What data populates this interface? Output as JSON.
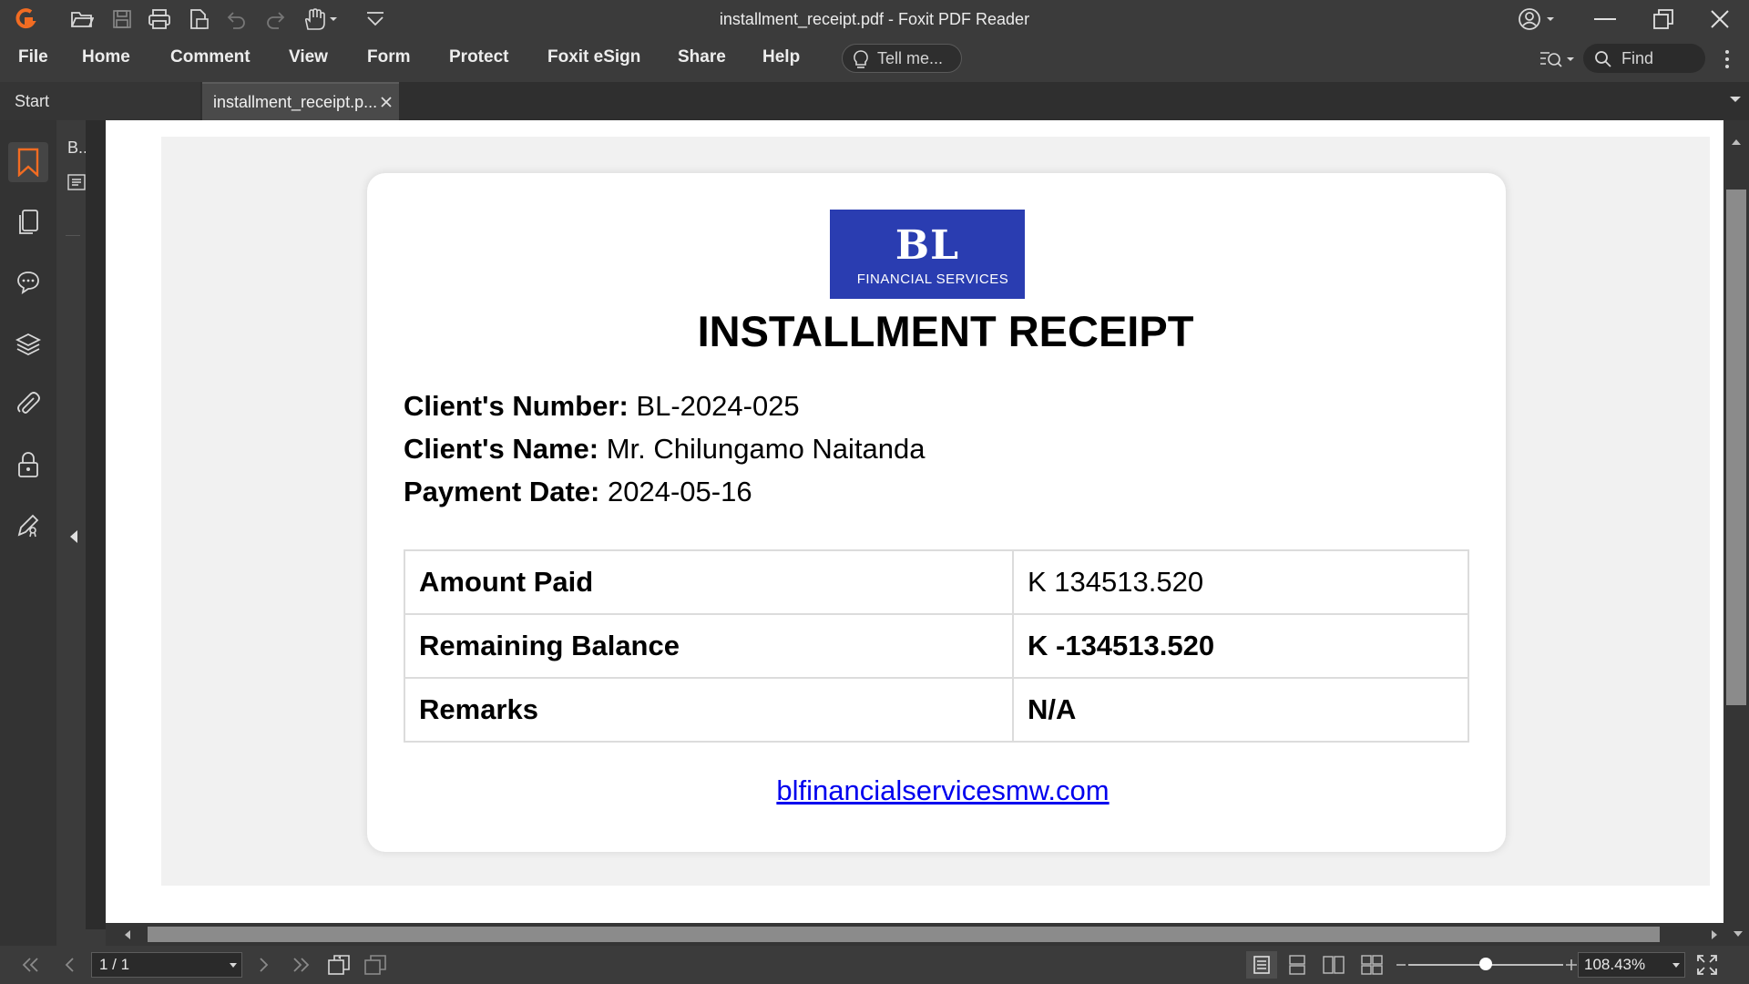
{
  "window": {
    "title": "installment_receipt.pdf - Foxit PDF Reader"
  },
  "menu": {
    "items": [
      "File",
      "Home",
      "Comment",
      "View",
      "Form",
      "Protect",
      "Foxit eSign",
      "Share",
      "Help"
    ],
    "tell_me_placeholder": "Tell me...",
    "find_placeholder": "Find"
  },
  "tabs": {
    "start_label": "Start",
    "doc_label": "installment_receipt.p..."
  },
  "bookmarks_panel": {
    "label": "B.."
  },
  "receipt": {
    "logo_initials": "BL",
    "logo_subtitle": "FINANCIAL SERVICES",
    "title": "INSTALLMENT RECEIPT",
    "fields": [
      {
        "label": "Client's Number:",
        "value": "BL-2024-025"
      },
      {
        "label": "Client's Name:",
        "value": "Mr. Chilungamo Naitanda"
      },
      {
        "label": "Payment Date:",
        "value": "2024-05-16"
      }
    ],
    "table": [
      {
        "key": "Amount Paid",
        "value": "K 134513.520"
      },
      {
        "key": "Remaining Balance",
        "value": "K -134513.520"
      },
      {
        "key": "Remarks",
        "value": "N/A"
      }
    ],
    "website": "blfinancialservicesmw.com"
  },
  "status": {
    "page_indicator": "1 / 1",
    "zoom": "108.43%"
  },
  "colors": {
    "accent": "#f26c22",
    "logo_blue": "#2a3db1",
    "link": "#0000ee"
  }
}
